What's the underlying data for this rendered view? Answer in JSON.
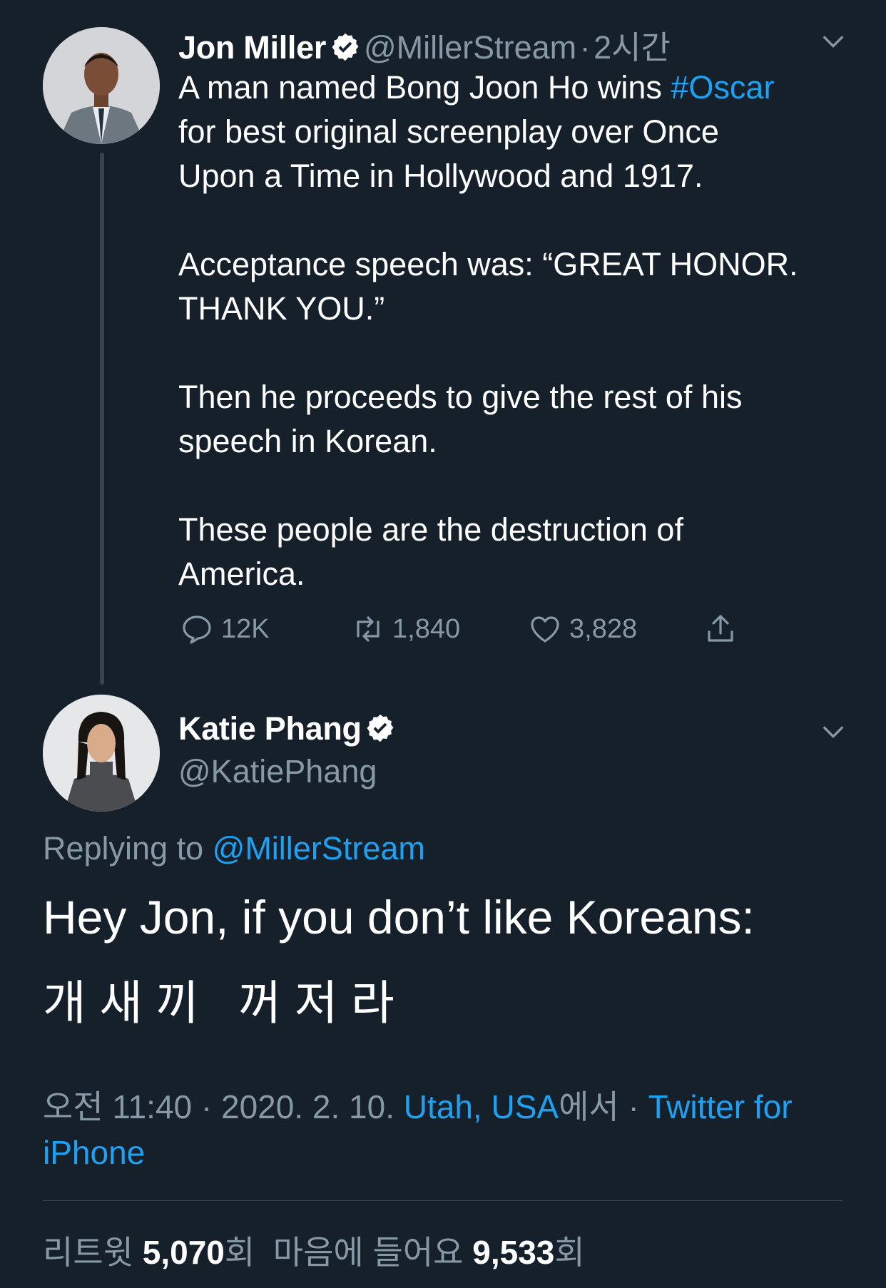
{
  "tweet1": {
    "author": "Jon Miller",
    "handle": "@MillerStream",
    "separator": "·",
    "time": "2시간",
    "text_before_hashtag": "A man named Bong Joon Ho wins ",
    "hashtag": "#Oscar",
    "text_after_hashtag": "for best original screenplay over Once\nUpon a Time in Hollywood and 1917.\n\nAcceptance speech was: “GREAT HONOR.\nTHANK YOU.”\n\nThen he proceeds to give the rest of his\nspeech in Korean.\n\nThese people are the destruction of\nAmerica.",
    "replies": "12K",
    "retweets": "1,840",
    "likes": "3,828"
  },
  "tweet2": {
    "author": "Katie Phang",
    "handle": "@KatiePhang",
    "replying_label": "Replying to ",
    "replying_to": "@MillerStream",
    "text_line1": "Hey Jon, if you don’t like Koreans:",
    "text_line2": "개 새 끼   꺼 저 라",
    "time": "오전 11:40 · 2020. 2. 10. ",
    "location": "Utah, USA",
    "location_suffix": "에서 · ",
    "source": "Twitter for iPhone",
    "retweets_label": "리트윗 ",
    "retweets_count": "5,070",
    "retweets_unit": "회  ",
    "likes_label": "마음에 들어요 ",
    "likes_count": "9,533",
    "likes_unit": "회"
  },
  "colors": {
    "background": "#15202b",
    "accent": "#1da1f2",
    "secondary_text": "#8899a6",
    "divider": "#38444d"
  },
  "icons": [
    "verified-badge-icon",
    "chevron-down-icon",
    "reply-icon",
    "retweet-icon",
    "like-icon",
    "share-icon"
  ]
}
